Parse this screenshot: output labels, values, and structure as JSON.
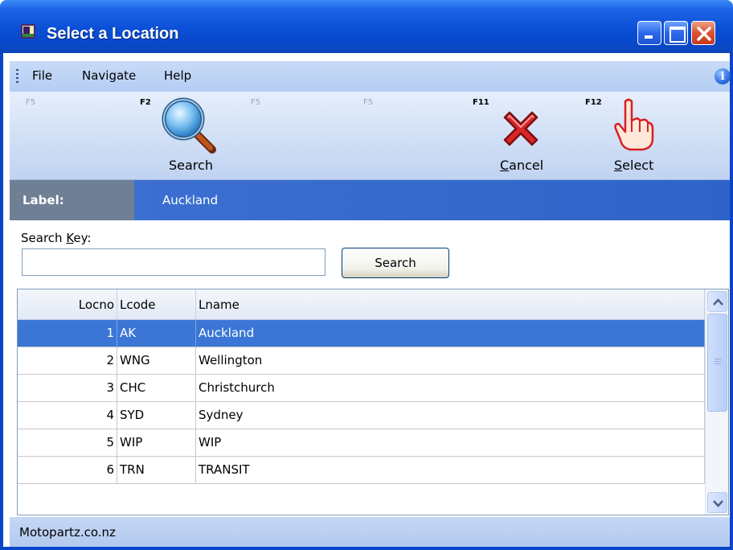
{
  "window": {
    "title": "Select a Location"
  },
  "menu": {
    "file": "File",
    "navigate": "Navigate",
    "help": "Help"
  },
  "toolbar": {
    "slots": [
      {
        "key": "F5",
        "enabled": false
      },
      {
        "key": "F2",
        "label": "Search",
        "icon": "magnifier-icon",
        "enabled": true
      },
      {
        "key": "F5",
        "enabled": false
      },
      {
        "key": "F5",
        "enabled": false
      },
      {
        "key": "F11",
        "label_prefix": "C",
        "label_rest": "ancel",
        "icon": "red-x-icon",
        "enabled": true
      },
      {
        "key": "F12",
        "label_prefix": "S",
        "label_rest": "elect",
        "icon": "pointing-hand-icon",
        "enabled": true
      }
    ]
  },
  "label_band": {
    "caption": "Label:",
    "value": "Auckland"
  },
  "search": {
    "key_label_prefix": "Search ",
    "key_label_underlined": "K",
    "key_label_rest": "ey:",
    "value": "",
    "button": "Search"
  },
  "grid": {
    "columns": [
      "Locno",
      "Lcode",
      "Lname"
    ],
    "selected_row": 0,
    "rows": [
      {
        "locno": "1",
        "lcode": "AK",
        "lname": "Auckland"
      },
      {
        "locno": "2",
        "lcode": "WNG",
        "lname": "Wellington"
      },
      {
        "locno": "3",
        "lcode": "CHC",
        "lname": "Christchurch"
      },
      {
        "locno": "4",
        "lcode": "SYD",
        "lname": "Sydney"
      },
      {
        "locno": "5",
        "lcode": "WIP",
        "lname": "WIP"
      },
      {
        "locno": "6",
        "lcode": "TRN",
        "lname": "TRANSIT"
      }
    ]
  },
  "status": {
    "text": "Motopartz.co.nz"
  },
  "colors": {
    "title_bar": "#0a4fd6",
    "selection": "#3b76d6",
    "label_band": "#2f63c8"
  }
}
